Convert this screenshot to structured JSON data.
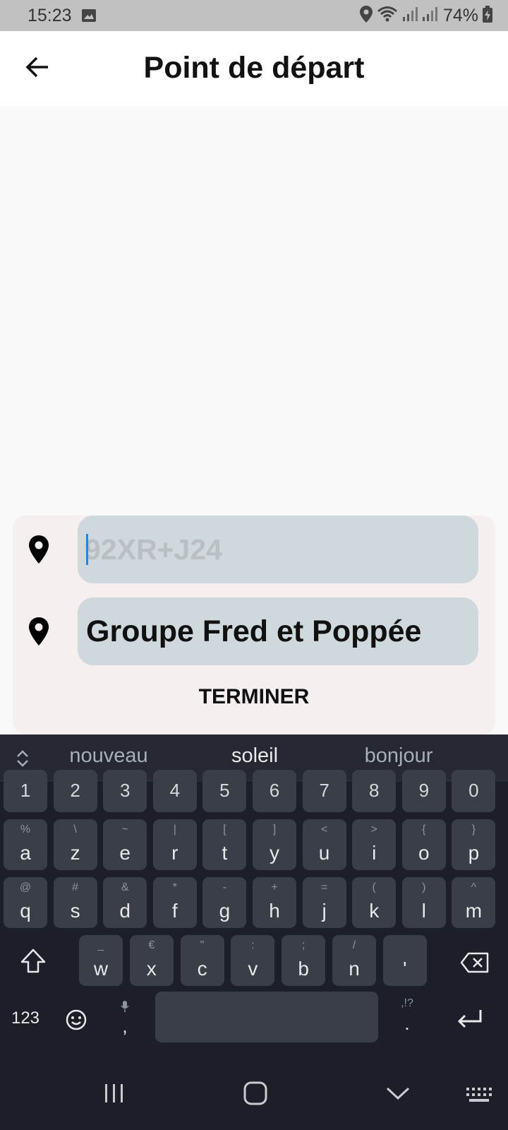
{
  "status_bar": {
    "time": "15:23",
    "battery": "74%",
    "icons": [
      "image-icon",
      "location-icon",
      "wifi-icon",
      "signal-icon",
      "signal-icon-2",
      "battery-charging-icon"
    ]
  },
  "header": {
    "title": "Point de départ",
    "back_icon": "arrow-left-icon"
  },
  "route": {
    "start_placeholder": "92XR+J24",
    "start_value": "",
    "destination_value": "Groupe Fred et Poppée",
    "finish_label": "TERMINER",
    "pin_icon": "map-pin-icon"
  },
  "keyboard": {
    "suggestions": [
      "nouveau",
      "soleil",
      "bonjour"
    ],
    "number_row": [
      "1",
      "2",
      "3",
      "4",
      "5",
      "6",
      "7",
      "8",
      "9",
      "0"
    ],
    "row1": [
      {
        "k": "a",
        "s": "%"
      },
      {
        "k": "z",
        "s": "\\"
      },
      {
        "k": "e",
        "s": "~"
      },
      {
        "k": "r",
        "s": "|"
      },
      {
        "k": "t",
        "s": "["
      },
      {
        "k": "y",
        "s": "]"
      },
      {
        "k": "u",
        "s": "<"
      },
      {
        "k": "i",
        "s": ">"
      },
      {
        "k": "o",
        "s": "{"
      },
      {
        "k": "p",
        "s": "}"
      }
    ],
    "row2": [
      {
        "k": "q",
        "s": "@"
      },
      {
        "k": "s",
        "s": "#"
      },
      {
        "k": "d",
        "s": "&"
      },
      {
        "k": "f",
        "s": "*"
      },
      {
        "k": "g",
        "s": "-"
      },
      {
        "k": "h",
        "s": "+"
      },
      {
        "k": "j",
        "s": "="
      },
      {
        "k": "k",
        "s": "("
      },
      {
        "k": "l",
        "s": ")"
      },
      {
        "k": "m",
        "s": "^"
      }
    ],
    "row3": [
      {
        "k": "w",
        "s": "_"
      },
      {
        "k": "x",
        "s": "€"
      },
      {
        "k": "c",
        "s": "\""
      },
      {
        "k": "v",
        "s": ":"
      },
      {
        "k": "b",
        "s": ";"
      },
      {
        "k": "n",
        "s": "/"
      },
      {
        "k": "'",
        "s": ""
      }
    ],
    "symbols_label": "123",
    "comma_label": ",",
    "period_label": ".",
    "period_sub": ",!?"
  },
  "colors": {
    "accent": "#1e88e5",
    "field_bg": "#cfd8dc",
    "card_bg": "#f5efef",
    "keyboard_bg": "#1c1f27",
    "key_bg": "#3a3e47"
  }
}
